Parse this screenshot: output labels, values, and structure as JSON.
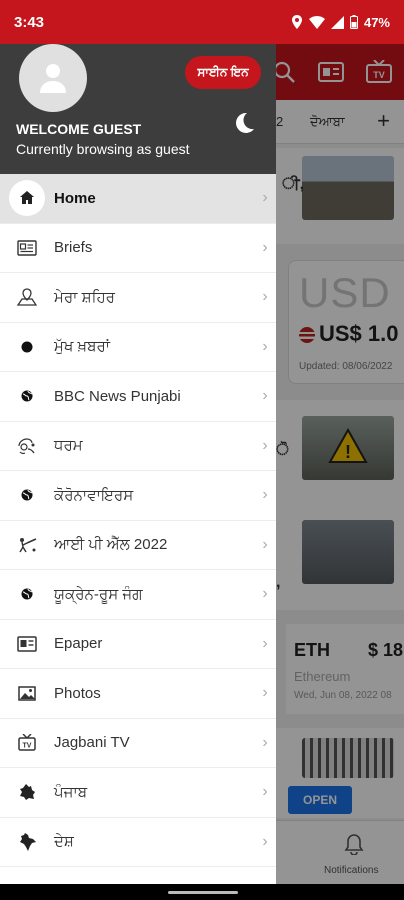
{
  "status_bar": {
    "time": "3:43",
    "battery": "47%"
  },
  "background": {
    "tab_label_partial": "2",
    "tab_label": "ਦੋਆਬਾ",
    "usd": {
      "code": "USD",
      "value": "US$ 1.0",
      "updated": "Updated: 08/06/2022"
    },
    "eth": {
      "code": "ETH",
      "price": "$ 18",
      "name": "Ethereum",
      "date": "Wed, Jun 08, 2022 08"
    },
    "open_label": "OPEN",
    "notifications_label": "Notifications"
  },
  "drawer": {
    "signin_label": "ਸਾਈਨ ਇਨ",
    "welcome": "WELCOME GUEST",
    "browsing": "Currently browsing as guest",
    "items": [
      {
        "label": "Home",
        "icon": "home-icon"
      },
      {
        "label": "Briefs",
        "icon": "briefs-icon"
      },
      {
        "label": "ਮੇਰਾ ਸ਼ਹਿਰ",
        "icon": "city-icon"
      },
      {
        "label": "ਮੁੱਖ ਖ਼ਬਰਾਂ",
        "icon": "dot-icon"
      },
      {
        "label": "BBC News Punjabi",
        "icon": "globe-icon"
      },
      {
        "label": "ਧਰਮ",
        "icon": "religion-icon"
      },
      {
        "label": "ਕੋਰੋਨਾਵਾਇਰਸ",
        "icon": "globe-icon"
      },
      {
        "label": "ਆਈ ਪੀ ਐੱਲ 2022",
        "icon": "cricket-icon"
      },
      {
        "label": "ਯੂਕ੍ਰੇਨ-ਰੂਸ ਜੰਗ",
        "icon": "globe-icon"
      },
      {
        "label": "Epaper",
        "icon": "epaper-icon"
      },
      {
        "label": "Photos",
        "icon": "photos-icon"
      },
      {
        "label": "Jagbani TV",
        "icon": "tv-icon"
      },
      {
        "label": "ਪੰਜਾਬ",
        "icon": "punjab-map-icon"
      },
      {
        "label": "ਦੇਸ਼",
        "icon": "india-map-icon"
      }
    ]
  },
  "colors": {
    "brand_red": "#c4161c",
    "drawer_header": "#3d3d3d",
    "active_row": "#e3e3e3",
    "open_button": "#1a73e8"
  }
}
